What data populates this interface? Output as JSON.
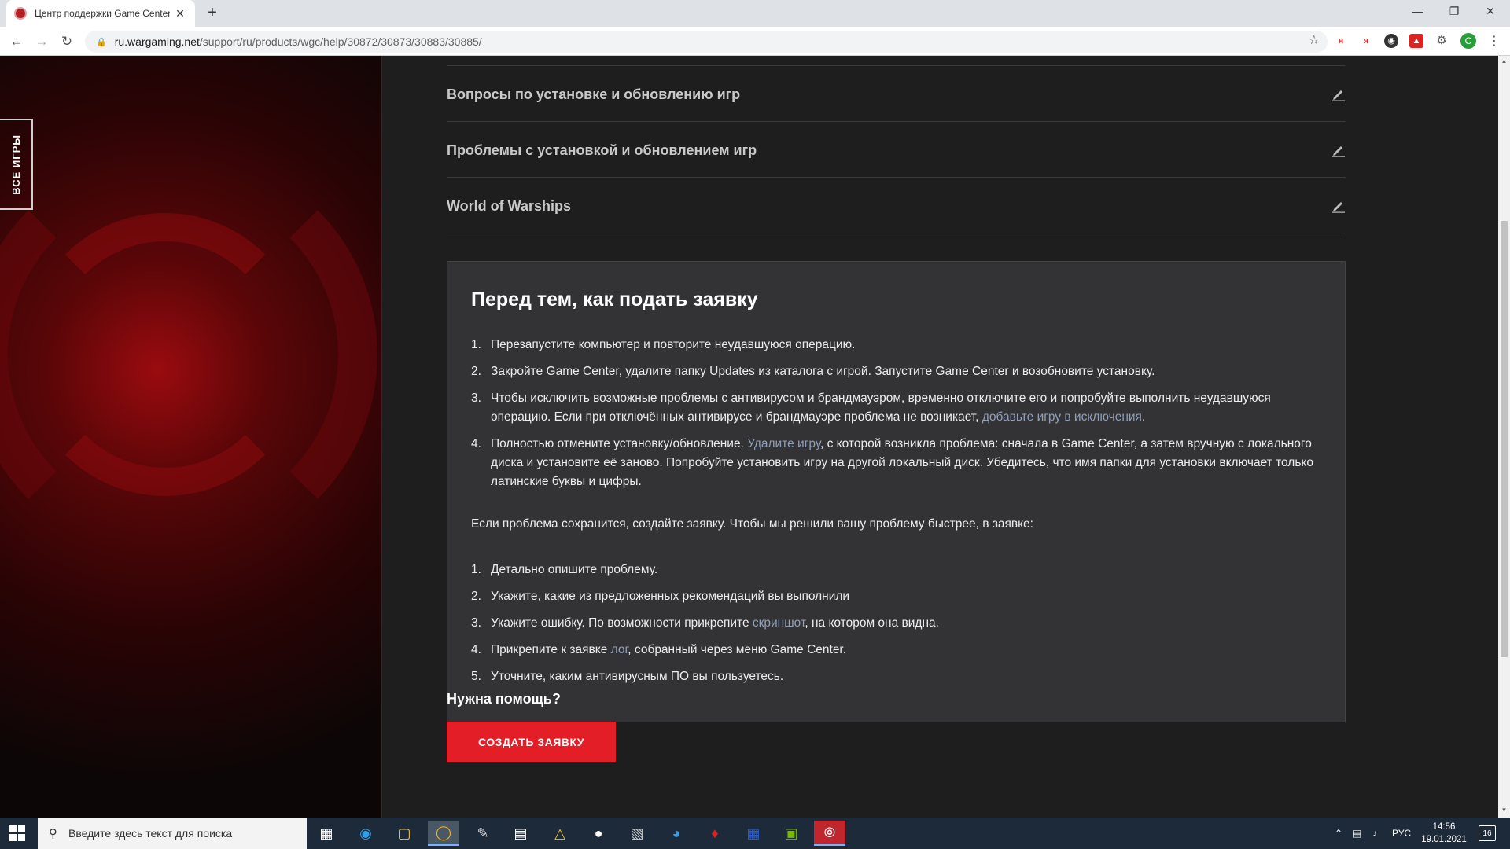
{
  "browser": {
    "tab_title": "Центр поддержки Game Center",
    "tab_close": "✕",
    "new_tab": "+",
    "url_host": "ru.wargaming.net",
    "url_path": "/support/ru/products/wgc/help/30872/30873/30883/30885/",
    "ext_labels": [
      "я",
      "я"
    ],
    "profile_initial": "C"
  },
  "sidebar": {
    "all_games_label": "ВСЕ ИГРЫ"
  },
  "accordion": [
    {
      "title": "Вопросы по установке и обновлению игр"
    },
    {
      "title": "Проблемы с установкой и обновлением игр"
    },
    {
      "title": "World of Warships"
    }
  ],
  "panel": {
    "heading": "Перед тем, как подать заявку",
    "steps": [
      {
        "num": "1.",
        "text": "Перезапустите компьютер и повторите неудавшуюся операцию."
      },
      {
        "num": "2.",
        "text": "Закройте Game Center, удалите папку Updates из каталога с игрой. Запустите Game Center и возобновите установку."
      },
      {
        "num": "3.",
        "before": "Чтобы исключить возможные проблемы с антивирусом и брандмауэром, временно отключите его и попробуйте выполнить неудавшуюся операцию. Если при отключённых антивирусе и брандмауэре проблема не возникает, ",
        "link": "добавьте игру в исключения",
        "after": "."
      },
      {
        "num": "4.",
        "before": "Полностью отмените установку/обновление. ",
        "link": "Удалите игру",
        "after": ", с которой возникла проблема: сначала в Game Center, а затем вручную с локального диска и установите её заново. Попробуйте установить игру на другой локальный диск. Убедитесь, что имя папки для установки включает только латинские буквы и цифры."
      }
    ],
    "paragraph": "Если проблема сохранится, создайте заявку. Чтобы мы решили вашу проблему быстрее, в заявке:",
    "requirements": [
      {
        "num": "1.",
        "text": "Детально опишите проблему."
      },
      {
        "num": "2.",
        "text": "Укажите, какие из предложенных рекомендаций вы выполнили"
      },
      {
        "num": "3.",
        "before": "Укажите ошибку. По возможности прикрепите ",
        "link": "скриншот",
        "after": ", на котором она видна."
      },
      {
        "num": "4.",
        "before": "Прикрепите к заявке ",
        "link": "лог",
        "after": ", собранный через меню Game Center."
      },
      {
        "num": "5.",
        "text": "Уточните, каким антивирусным ПО вы пользуетесь."
      }
    ]
  },
  "help": {
    "title": "Нужна помощь?",
    "button": "СОЗДАТЬ ЗАЯВКУ"
  },
  "taskbar": {
    "search_placeholder": "Введите здесь текст для поиска",
    "language": "РУС",
    "time": "14:56",
    "date": "19.01.2021",
    "notifications": "16"
  },
  "colors": {
    "accent": "#e31e27",
    "link": "#8f9fb8",
    "panel_bg": "#333335",
    "page_bg": "#1e1e1e"
  }
}
